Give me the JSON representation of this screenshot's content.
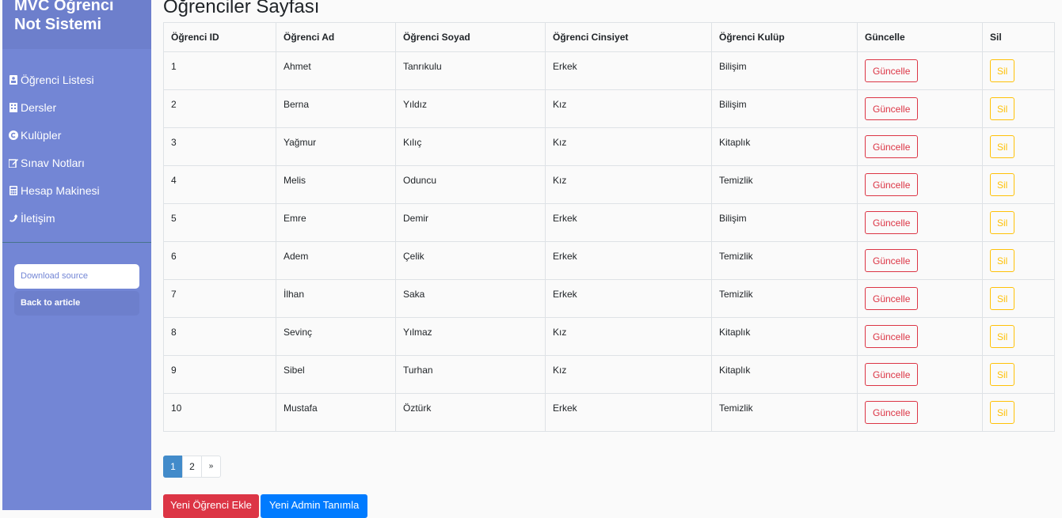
{
  "sidebar": {
    "title": "MVC Öğrenci Not Sistemi",
    "items": [
      {
        "label": "Öğrenci Listesi",
        "icon": "address-card-icon"
      },
      {
        "label": "Dersler",
        "icon": "building-icon"
      },
      {
        "label": "Kulüpler",
        "icon": "copyright-icon"
      },
      {
        "label": "Sınav Notları",
        "icon": "edit-icon"
      },
      {
        "label": "Hesap Makinesi",
        "icon": "calculator-icon"
      },
      {
        "label": "İletişim",
        "icon": "phone-icon"
      }
    ],
    "download_label": "Download source",
    "back_label": "Back to article"
  },
  "main": {
    "title": "Öğrenciler Sayfası",
    "columns": [
      "Öğrenci ID",
      "Öğrenci Ad",
      "Öğrenci Soyad",
      "Öğrenci Cinsiyet",
      "Öğrenci Kulüp",
      "Güncelle",
      "Sil"
    ],
    "rows": [
      {
        "id": "1",
        "ad": "Ahmet",
        "soyad": "Tanrıkulu",
        "cinsiyet": "Erkek",
        "kulup": "Bilişim"
      },
      {
        "id": "2",
        "ad": "Berna",
        "soyad": "Yıldız",
        "cinsiyet": "Kız",
        "kulup": "Bilişim"
      },
      {
        "id": "3",
        "ad": "Yağmur",
        "soyad": "Kılıç",
        "cinsiyet": "Kız",
        "kulup": "Kitaplık"
      },
      {
        "id": "4",
        "ad": "Melis",
        "soyad": "Oduncu",
        "cinsiyet": "Kız",
        "kulup": "Temizlik"
      },
      {
        "id": "5",
        "ad": "Emre",
        "soyad": "Demir",
        "cinsiyet": "Erkek",
        "kulup": "Bilişim"
      },
      {
        "id": "6",
        "ad": "Adem",
        "soyad": "Çelik",
        "cinsiyet": "Erkek",
        "kulup": "Temizlik"
      },
      {
        "id": "7",
        "ad": "İlhan",
        "soyad": "Saka",
        "cinsiyet": "Erkek",
        "kulup": "Temizlik"
      },
      {
        "id": "8",
        "ad": "Sevinç",
        "soyad": "Yılmaz",
        "cinsiyet": "Kız",
        "kulup": "Kitaplık"
      },
      {
        "id": "9",
        "ad": "Sibel",
        "soyad": "Turhan",
        "cinsiyet": "Kız",
        "kulup": "Kitaplık"
      },
      {
        "id": "10",
        "ad": "Mustafa",
        "soyad": "Öztürk",
        "cinsiyet": "Erkek",
        "kulup": "Temizlik"
      }
    ],
    "update_label": "Güncelle",
    "delete_label": "Sil",
    "pagination": [
      "1",
      "2",
      "»"
    ],
    "add_student_label": "Yeni Öğrenci Ekle",
    "add_admin_label": "Yeni Admin Tanımla"
  },
  "colors": {
    "sidebar_bg": "#7386d5",
    "update_border": "#dc3545",
    "delete_border": "#ffc107",
    "primary": "#007bff"
  }
}
